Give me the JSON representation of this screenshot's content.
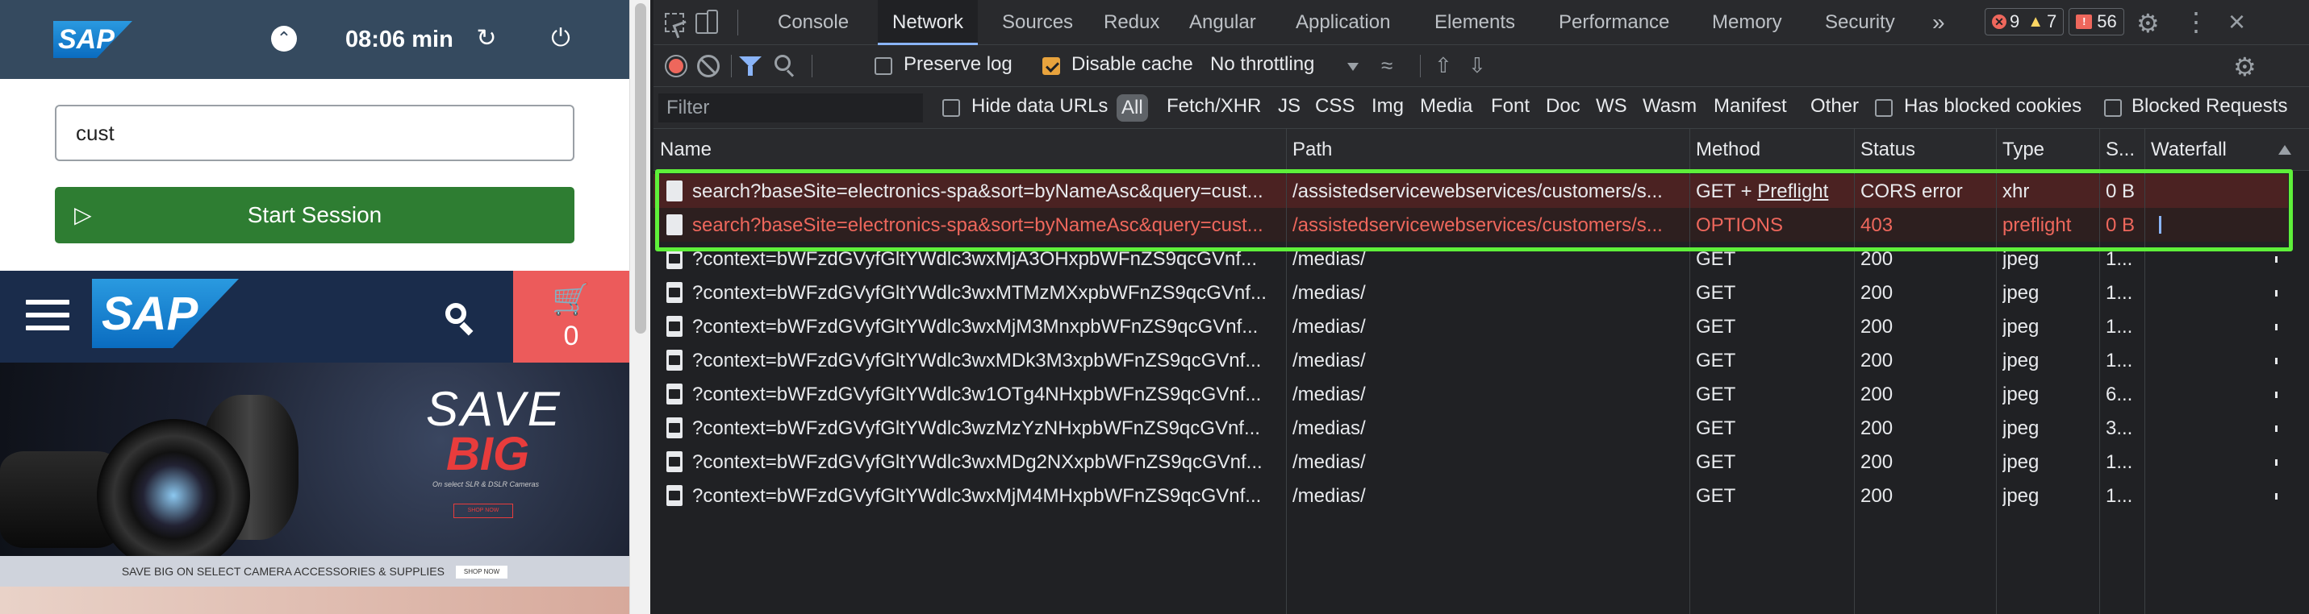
{
  "store": {
    "asm": {
      "logo": "SAP",
      "timer": "08:06 min",
      "customer_input_value": "cust",
      "start_session_label": "Start Session"
    },
    "header": {
      "logo": "SAP",
      "cart_count": "0"
    },
    "banner": {
      "headline_1": "SAVE",
      "headline_2": "BIG",
      "subtext": "On select SLR & DSLR Cameras",
      "shop_now": "SHOP NOW",
      "promo_text": "SAVE BIG ON SELECT CAMERA ACCESSORIES & SUPPLIES",
      "promo_button": "SHOP NOW"
    }
  },
  "devtools": {
    "tabs": [
      "Console",
      "Network",
      "Sources",
      "Redux",
      "Angular",
      "Application",
      "Elements",
      "Performance",
      "Memory",
      "Security"
    ],
    "active_tab": "Network",
    "more_tabs": "»",
    "badges": {
      "errors": "9",
      "warnings": "7",
      "issues": "56"
    },
    "toolbar": {
      "preserve_log": "Preserve log",
      "disable_cache": "Disable cache",
      "throttling": "No throttling"
    },
    "filter_bar": {
      "placeholder": "Filter",
      "hide_data_urls": "Hide data URLs",
      "types": [
        "All",
        "Fetch/XHR",
        "JS",
        "CSS",
        "Img",
        "Media",
        "Font",
        "Doc",
        "WS",
        "Wasm",
        "Manifest",
        "Other"
      ],
      "has_blocked_cookies": "Has blocked cookies",
      "blocked_requests": "Blocked Requests"
    },
    "columns": [
      "Name",
      "Path",
      "Method",
      "Status",
      "Type",
      "S...",
      "Waterfall"
    ],
    "rows": [
      {
        "name": "search?baseSite=electronics-spa&sort=byNameAsc&query=cust...",
        "path": "/assistedservicewebservices/customers/s...",
        "method": "GET + ",
        "method_link": "Preflight",
        "status": "CORS error",
        "type": "xhr",
        "size": "0 B"
      },
      {
        "name": "search?baseSite=electronics-spa&sort=byNameAsc&query=cust...",
        "path": "/assistedservicewebservices/customers/s...",
        "method": "OPTIONS",
        "method_link": "",
        "status": "403",
        "type": "preflight",
        "size": "0 B"
      },
      {
        "name": "?context=bWFzdGVyfGltYWdlc3wxMjA3OHxpbWFnZS9qcGVnf...",
        "path": "/medias/",
        "method": "GET",
        "method_link": "",
        "status": "200",
        "type": "jpeg",
        "size": "1..."
      },
      {
        "name": "?context=bWFzdGVyfGltYWdlc3wxMTMzMXxpbWFnZS9qcGVnf...",
        "path": "/medias/",
        "method": "GET",
        "method_link": "",
        "status": "200",
        "type": "jpeg",
        "size": "1..."
      },
      {
        "name": "?context=bWFzdGVyfGltYWdlc3wxMjM3MnxpbWFnZS9qcGVnf...",
        "path": "/medias/",
        "method": "GET",
        "method_link": "",
        "status": "200",
        "type": "jpeg",
        "size": "1..."
      },
      {
        "name": "?context=bWFzdGVyfGltYWdlc3wxMDk3M3xpbWFnZS9qcGVnf...",
        "path": "/medias/",
        "method": "GET",
        "method_link": "",
        "status": "200",
        "type": "jpeg",
        "size": "1..."
      },
      {
        "name": "?context=bWFzdGVyfGltYWdlc3w1OTg4NHxpbWFnZS9qcGVnf...",
        "path": "/medias/",
        "method": "GET",
        "method_link": "",
        "status": "200",
        "type": "jpeg",
        "size": "6..."
      },
      {
        "name": "?context=bWFzdGVyfGltYWdlc3wzMzYzNHxpbWFnZS9qcGVnf...",
        "path": "/medias/",
        "method": "GET",
        "method_link": "",
        "status": "200",
        "type": "jpeg",
        "size": "3..."
      },
      {
        "name": "?context=bWFzdGVyfGltYWdlc3wxMDg2NXxpbWFnZS9qcGVnf...",
        "path": "/medias/",
        "method": "GET",
        "method_link": "",
        "status": "200",
        "type": "jpeg",
        "size": "1..."
      },
      {
        "name": "?context=bWFzdGVyfGltYWdlc3wxMjM4MHxpbWFnZS9qcGVnf...",
        "path": "/medias/",
        "method": "GET",
        "method_link": "",
        "status": "200",
        "type": "jpeg",
        "size": "1..."
      }
    ]
  }
}
